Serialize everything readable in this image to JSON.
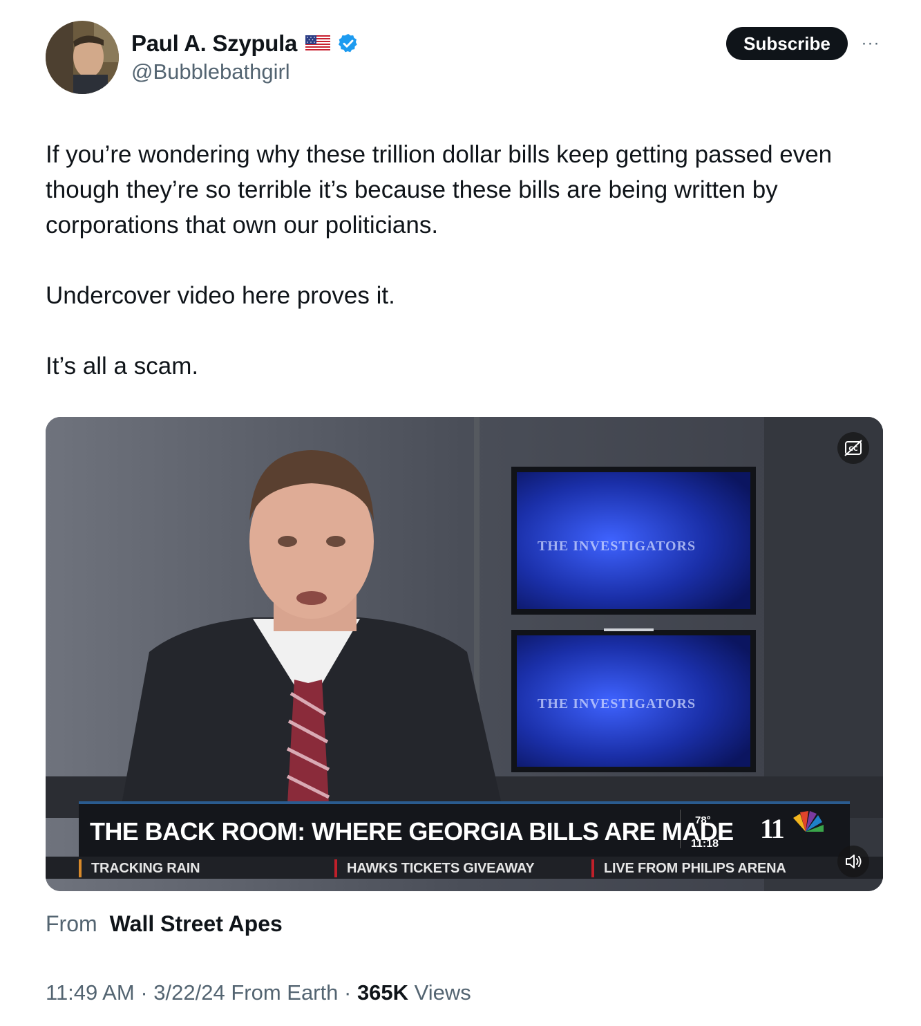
{
  "author": {
    "display_name": "Paul A. Szypula",
    "handle": "@Bubblebathgirl",
    "flag_icon": "us-flag-icon",
    "verified_icon": "verified-badge-icon",
    "verified_color": "#1d9bf0"
  },
  "header": {
    "subscribe_label": "Subscribe",
    "more_label": "···"
  },
  "tweet": {
    "paragraphs": [
      "If you’re wondering why these trillion dollar bills keep getting passed even though they’re so terrible it’s because these bills are being written by corporations that own our politicians.",
      "Undercover video here proves it.",
      "It’s all a scam."
    ]
  },
  "media": {
    "chyron_main": "THE BACK ROOM: WHERE GEORGIA BILLS ARE MADE",
    "temperature": "78°",
    "time": "11:18",
    "station": "11",
    "monitor_label": "THE INVESTIGATORS",
    "ticker": [
      "TRACKING RAIN",
      "HAWKS TICKETS GIVEAWAY",
      "LIVE FROM PHILIPS ARENA"
    ],
    "captions_icon": "closed-captions-icon",
    "mute_icon": "speaker-icon"
  },
  "attribution": {
    "from_label": "From",
    "source": "Wall Street Apes"
  },
  "meta": {
    "time": "11:49 AM",
    "separator": "·",
    "date": "3/22/24",
    "location": "From Earth",
    "views_count": "365K",
    "views_label": "Views"
  }
}
